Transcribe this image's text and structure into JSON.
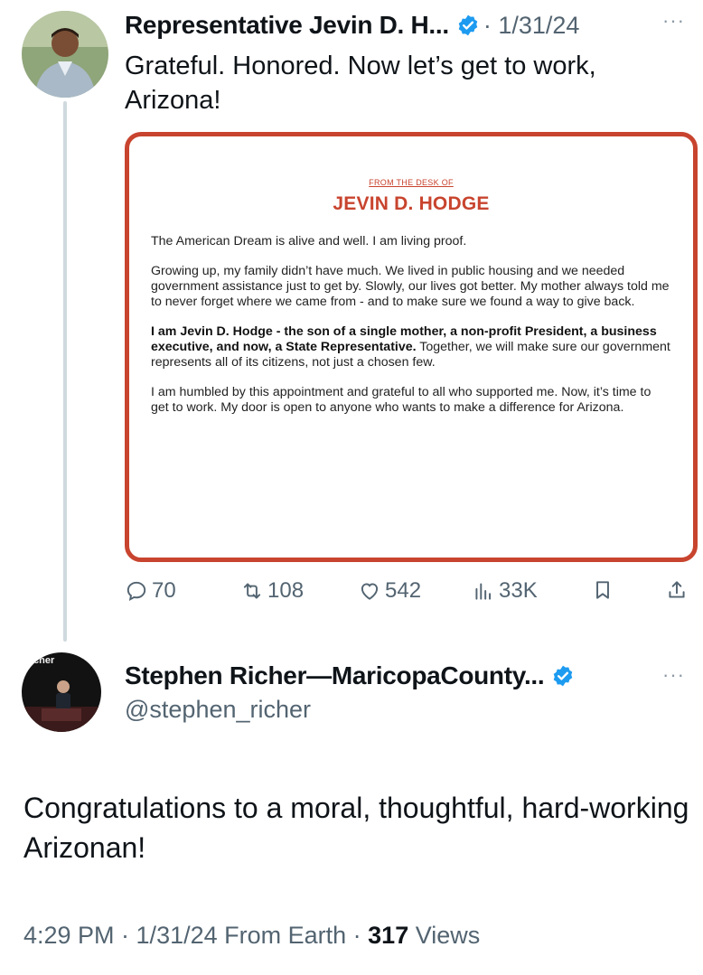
{
  "tweet1": {
    "author_name": "Representative Jevin D. H...",
    "date": "· 1/31/24",
    "more": "···",
    "text": "Grateful. Honored. Now let’s get to work, Arizona!",
    "letter": {
      "from": "FROM THE DESK OF",
      "name": "JEVIN D. HODGE",
      "p1": "The American Dream is alive and well.  I am living proof.",
      "p2": "Growing up, my family didn’t have much.  We lived in public housing and we needed government assistance just to get by.  Slowly, our lives got better.  My mother always told me to never forget where we came from - and to make sure we found a way to give back.",
      "p3_bold": "I am Jevin D. Hodge - the son of a single mother, a non-profit President, a business executive, and now, a State Representative.",
      "p3_rest": "  Together, we will make sure our government represents all of its citizens, not just a chosen few.",
      "p4": "I am humbled by this appointment and grateful to all who supported me. Now, it’s time to get to work. My door is open to anyone who wants to make a difference for Arizona."
    },
    "actions": {
      "replies": "70",
      "reposts": "108",
      "likes": "542",
      "views": "33K"
    }
  },
  "tweet2": {
    "author_name": "Stephen Richer—MaricopaCounty...",
    "handle": "@stephen_richer",
    "more": "···",
    "avatar_label": "Richer",
    "text": "Congratulations to a moral, thoughtful, hard-working Arizonan!",
    "meta": {
      "time_date": "4:29 PM · 1/31/24 From Earth · ",
      "views_count": "317",
      "views_label": " Views"
    }
  },
  "colors": {
    "verified": "#1d9bf0",
    "letter_accent": "#c8442e",
    "secondary_text": "#536471"
  }
}
